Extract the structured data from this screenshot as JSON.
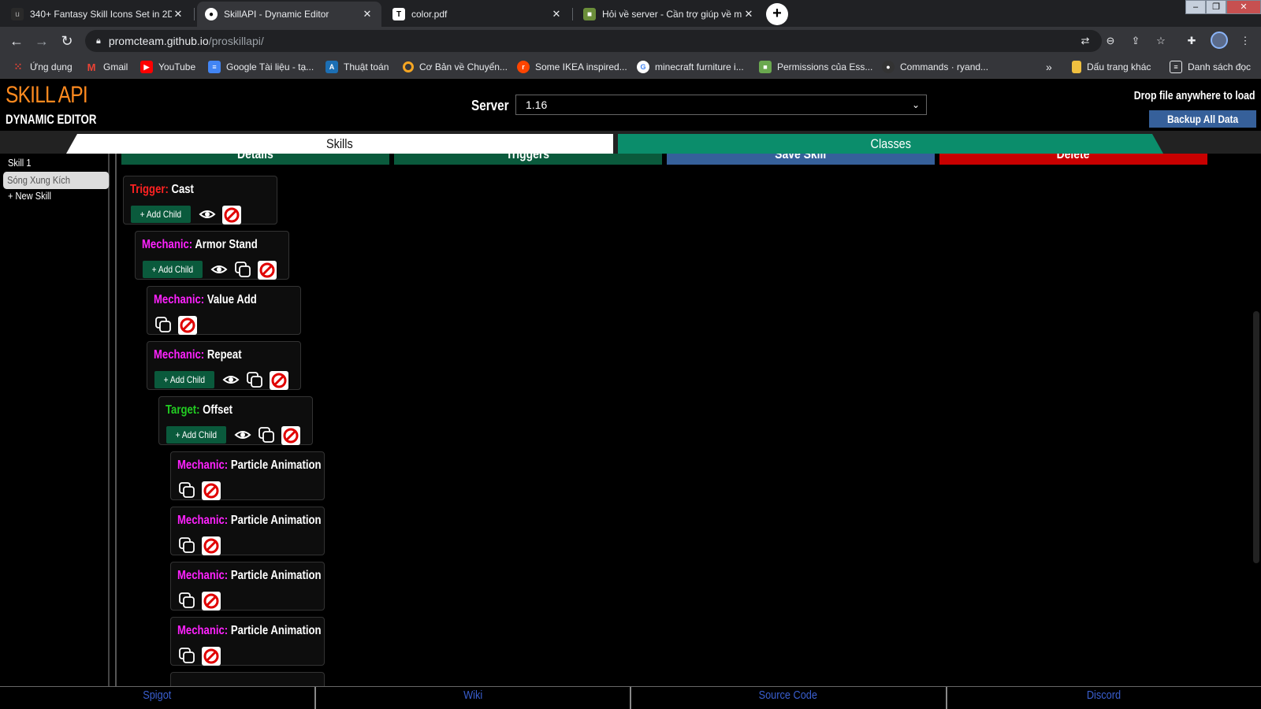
{
  "browser": {
    "tabs": [
      {
        "title": "340+ Fantasy Skill Icons Set in 2D",
        "icon": "game-art-icon"
      },
      {
        "title": "SkillAPI - Dynamic Editor",
        "icon": "github-icon"
      },
      {
        "title": "color.pdf",
        "icon": "tex-icon"
      },
      {
        "title": "Hỏi về server - Cần trợ giúp về m",
        "icon": "minecraft-icon"
      }
    ],
    "address": {
      "domain": "promcteam.github.io",
      "path": "/proskillapi/"
    },
    "bookmarks": [
      {
        "label": "Ứng dụng",
        "icon": "apps-grid-icon",
        "color": "#ea4335"
      },
      {
        "label": "Gmail",
        "icon": "gmail-icon",
        "color": "#ea4335"
      },
      {
        "label": "YouTube",
        "icon": "youtube-icon",
        "color": "#ff0000"
      },
      {
        "label": "Google Tài liệu - tạ...",
        "icon": "docs-icon",
        "color": "#4285f4"
      },
      {
        "label": "Thuật toán",
        "icon": "algo-icon",
        "color": "#1c6fb4"
      },
      {
        "label": "Cơ Bản về Chuyển...",
        "icon": "circle-icon",
        "color": "#f5a623"
      },
      {
        "label": "Some IKEA inspired...",
        "icon": "reddit-icon",
        "color": "#ff4500"
      },
      {
        "label": "minecraft furniture i...",
        "icon": "google-icon",
        "color": "#ffffff"
      },
      {
        "label": "Permissions của Ess...",
        "icon": "essentials-icon",
        "color": "#6aa84f"
      },
      {
        "label": "Commands · ryand...",
        "icon": "github-icon",
        "color": "#333333"
      }
    ],
    "bookmarks_more": "»",
    "other_bookmarks": "Dấu trang khác",
    "reading_list": "Danh sách đọc"
  },
  "header": {
    "logo_title": "SKILL API",
    "logo_subtitle": "DYNAMIC EDITOR",
    "server_label": "Server",
    "server_value": "1.16",
    "drop_text": "Drop file anywhere to load",
    "backup_label": "Backup All Data"
  },
  "main_tabs": {
    "skills": "Skills",
    "classes": "Classes"
  },
  "sidebar": {
    "items": [
      "Skill 1",
      "Sóng Xung Kích",
      "+ New Skill"
    ],
    "selected": "Sóng Xung Kích"
  },
  "actions": {
    "details": "Details",
    "triggers": "Triggers",
    "save": "Save Skill",
    "delete": "Delete"
  },
  "add_child_label": "+ Add Child",
  "nodes": [
    {
      "type": "Trigger:",
      "name": "Cast"
    },
    {
      "type": "Mechanic:",
      "name": "Armor Stand"
    },
    {
      "type": "Mechanic:",
      "name": "Value Add"
    },
    {
      "type": "Mechanic:",
      "name": "Repeat"
    },
    {
      "type": "Target:",
      "name": "Offset"
    },
    {
      "type": "Mechanic:",
      "name": "Particle Animation"
    },
    {
      "type": "Mechanic:",
      "name": "Particle Animation"
    },
    {
      "type": "Mechanic:",
      "name": "Particle Animation"
    },
    {
      "type": "Mechanic:",
      "name": "Particle Animation"
    }
  ],
  "colors": {
    "trigger": "#ff2222",
    "mechanic": "#ff22ff",
    "target": "#22cc22",
    "accent_green": "#0b8d6b",
    "save_blue": "#36609a",
    "delete_red": "#c80000"
  },
  "footer": [
    "Spigot",
    "Wiki",
    "Source Code",
    "Discord"
  ]
}
